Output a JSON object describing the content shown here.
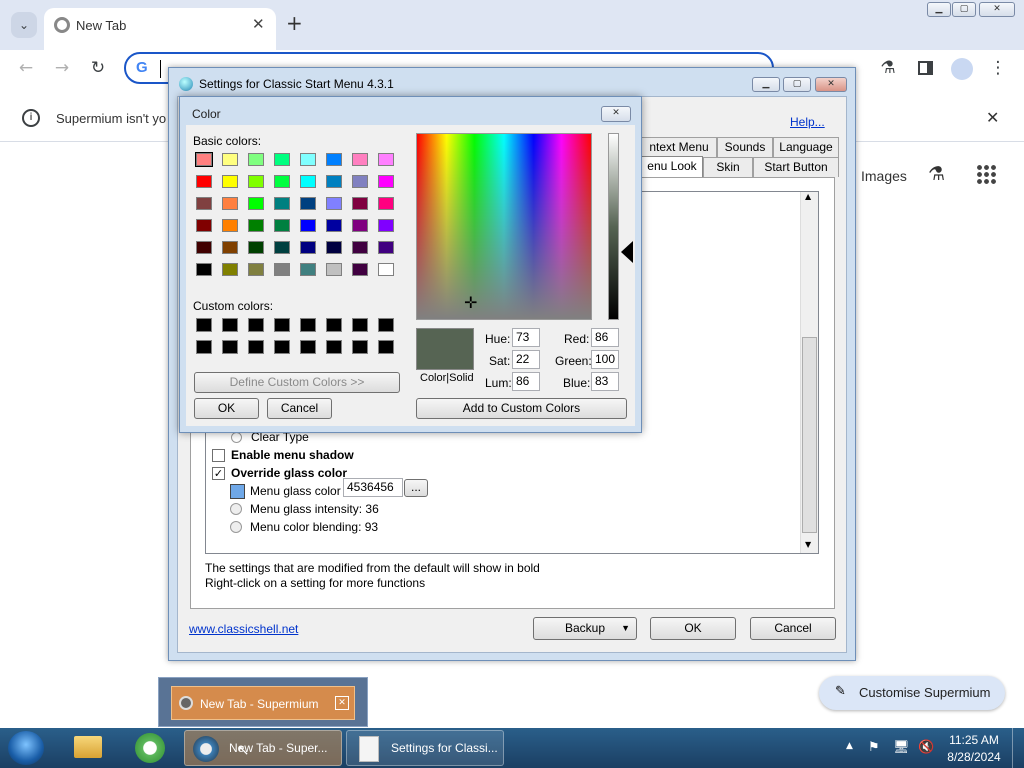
{
  "browser": {
    "tab_title": "New Tab",
    "new_tab": "+",
    "info_text": "Supermium isn't yo",
    "help": "Help...",
    "images": "Images",
    "customise": "Customise Supermium"
  },
  "settings": {
    "title": "Settings for Classic Start Menu 4.3.1",
    "tabs_row1": [
      "ntext Menu",
      "Sounds",
      "Language"
    ],
    "tabs_row2": [
      "enu Look",
      "Skin",
      "Start Button"
    ],
    "items": {
      "clear_type": "Clear Type",
      "enable_shadow": "Enable menu shadow",
      "override_glass": "Override glass color",
      "glass_color_label": "Menu glass color",
      "glass_color_value": "4536456",
      "browse": "...",
      "glass_intensity": "Menu glass intensity: 36",
      "color_blending": "Menu color blending: 93"
    },
    "note1": "The settings that are modified from the default will show in bold",
    "note2": "Right-click on a setting for more functions",
    "link": "www.classicshell.net",
    "backup": "Backup",
    "ok": "OK",
    "cancel": "Cancel",
    "glass_swatch": "#6fa8e8"
  },
  "color_dialog": {
    "title": "Color",
    "basic_label": "Basic colors:",
    "custom_label": "Custom colors:",
    "define_custom": "Define Custom Colors >>",
    "ok": "OK",
    "cancel": "Cancel",
    "color_solid": "Color|Solid",
    "hue_label": "Hue:",
    "hue": "73",
    "sat_label": "Sat:",
    "sat": "22",
    "lum_label": "Lum:",
    "lum": "86",
    "red_label": "Red:",
    "red": "86",
    "green_label": "Green:",
    "green": "100",
    "blue_label": "Blue:",
    "blue": "83",
    "add_custom": "Add to Custom Colors",
    "current_color": "#566453",
    "basic_colors": [
      "#ff8080",
      "#ffff80",
      "#80ff80",
      "#00ff80",
      "#80ffff",
      "#0080ff",
      "#ff80c0",
      "#ff80ff",
      "#ff0000",
      "#ffff00",
      "#80ff00",
      "#00ff40",
      "#00ffff",
      "#0080c0",
      "#8080c0",
      "#ff00ff",
      "#804040",
      "#ff8040",
      "#00ff00",
      "#008080",
      "#004080",
      "#8080ff",
      "#800040",
      "#ff0080",
      "#800000",
      "#ff8000",
      "#008000",
      "#008040",
      "#0000ff",
      "#0000a0",
      "#800080",
      "#8000ff",
      "#400000",
      "#804000",
      "#004000",
      "#004040",
      "#000080",
      "#000040",
      "#400040",
      "#400080",
      "#000000",
      "#808000",
      "#808040",
      "#808080",
      "#408080",
      "#c0c0c0",
      "#400040",
      "#ffffff"
    ]
  },
  "taskbar": {
    "thumb_label": "New Tab - Supermium",
    "task1": "New Tab - Super...",
    "task2": "Settings for Classi...",
    "time": "11:25 AM",
    "date": "8/28/2024"
  }
}
